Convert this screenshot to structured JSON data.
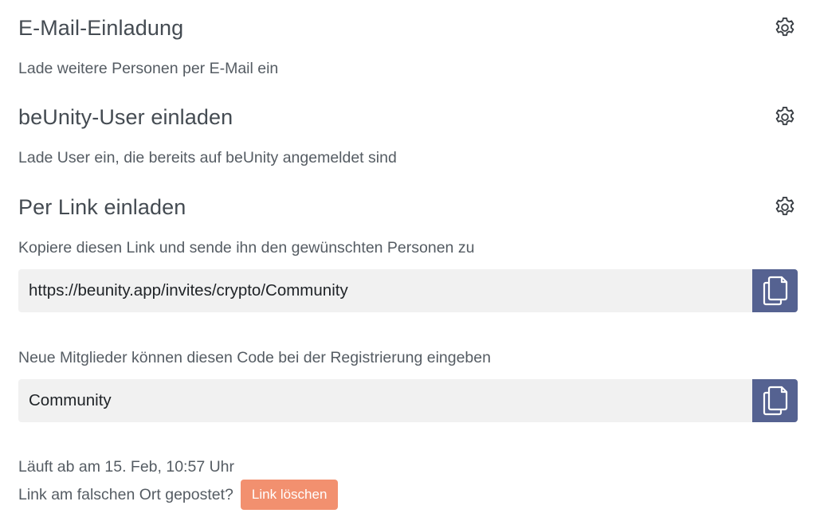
{
  "email_invite": {
    "title": "E-Mail-Einladung",
    "description": "Lade weitere Personen per E-Mail ein",
    "settings_icon": "gear-icon"
  },
  "user_invite": {
    "title": "beUnity-User einladen",
    "description": "Lade User ein, die bereits auf beUnity angemeldet sind",
    "settings_icon": "gear-icon"
  },
  "link_invite": {
    "title": "Per Link einladen",
    "description": "Kopiere diesen Link und sende ihn den gewünschten Personen zu",
    "settings_icon": "gear-icon",
    "link_value": "https://beunity.app/invites/crypto/Community",
    "copy_icon": "copy-icon"
  },
  "code_invite": {
    "description": "Neue Mitglieder können diesen Code bei der Registrierung eingeben",
    "code_value": "Community",
    "copy_icon": "copy-icon"
  },
  "footer": {
    "expiry_text": "Läuft ab am 15. Feb, 10:57 Uhr",
    "wrong_place_text": "Link am falschen Ort gepostet?",
    "delete_button_label": "Link löschen"
  },
  "colors": {
    "copy_button_bg": "#556291",
    "delete_button_bg": "#f2906f",
    "field_bg": "#f1f1f1",
    "text": "#444b52"
  }
}
